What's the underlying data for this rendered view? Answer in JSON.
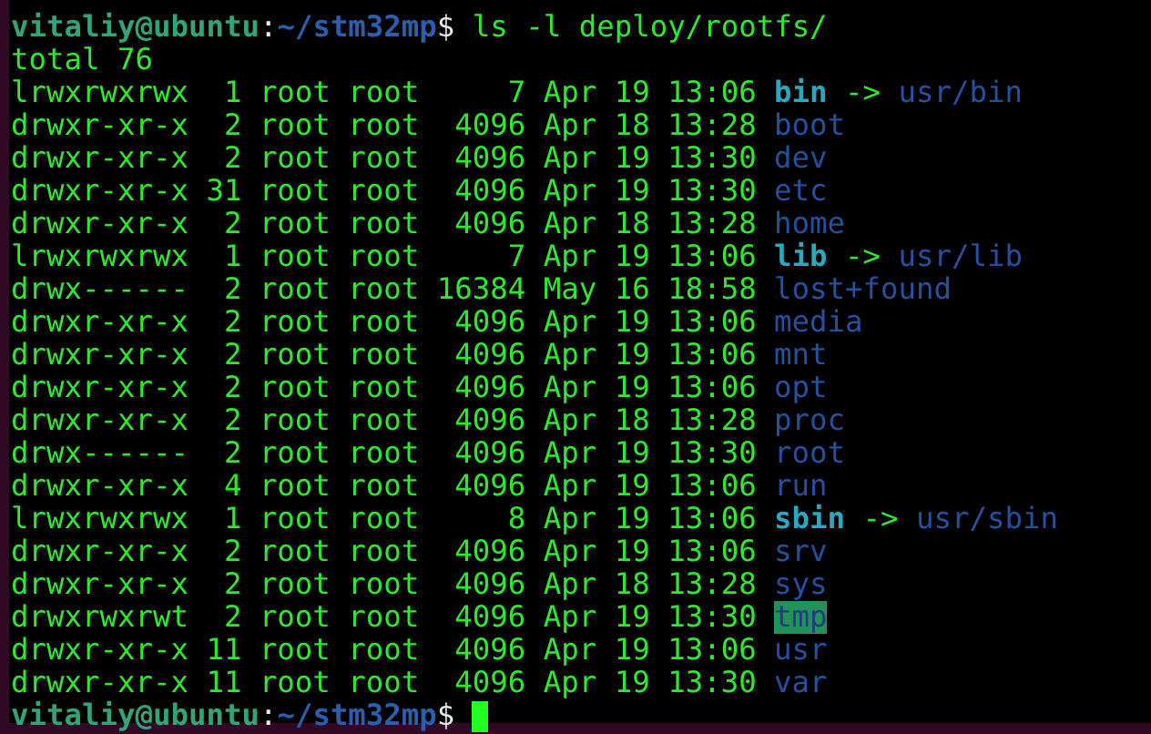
{
  "terminal": {
    "command_prompt": {
      "user_host": "vitaliy@ubuntu",
      "separator": ":",
      "path": "~/stm32mp",
      "symbol": "$",
      "command": "ls -l deploy/rootfs/"
    },
    "total": "total 76",
    "entries": [
      {
        "info": "lrwxrwxrwx  1 root root     7 Apr 19 13:06",
        "name": "bin",
        "kind": "link",
        "arrow": "->",
        "target": "usr/bin"
      },
      {
        "info": "drwxr-xr-x  2 root root  4096 Apr 18 13:28",
        "name": "boot",
        "kind": "dir"
      },
      {
        "info": "drwxr-xr-x  2 root root  4096 Apr 19 13:30",
        "name": "dev",
        "kind": "dir"
      },
      {
        "info": "drwxr-xr-x 31 root root  4096 Apr 19 13:30",
        "name": "etc",
        "kind": "dir"
      },
      {
        "info": "drwxr-xr-x  2 root root  4096 Apr 18 13:28",
        "name": "home",
        "kind": "dir"
      },
      {
        "info": "lrwxrwxrwx  1 root root     7 Apr 19 13:06",
        "name": "lib",
        "kind": "link",
        "arrow": "->",
        "target": "usr/lib"
      },
      {
        "info": "drwx------  2 root root 16384 May 16 18:58",
        "name": "lost+found",
        "kind": "dir"
      },
      {
        "info": "drwxr-xr-x  2 root root  4096 Apr 19 13:06",
        "name": "media",
        "kind": "dir"
      },
      {
        "info": "drwxr-xr-x  2 root root  4096 Apr 19 13:06",
        "name": "mnt",
        "kind": "dir"
      },
      {
        "info": "drwxr-xr-x  2 root root  4096 Apr 19 13:06",
        "name": "opt",
        "kind": "dir"
      },
      {
        "info": "drwxr-xr-x  2 root root  4096 Apr 18 13:28",
        "name": "proc",
        "kind": "dir"
      },
      {
        "info": "drwx------  2 root root  4096 Apr 19 13:30",
        "name": "root",
        "kind": "dir"
      },
      {
        "info": "drwxr-xr-x  4 root root  4096 Apr 19 13:06",
        "name": "run",
        "kind": "dir"
      },
      {
        "info": "lrwxrwxrwx  1 root root     8 Apr 19 13:06",
        "name": "sbin",
        "kind": "link",
        "arrow": "->",
        "target": "usr/sbin"
      },
      {
        "info": "drwxr-xr-x  2 root root  4096 Apr 19 13:06",
        "name": "srv",
        "kind": "dir"
      },
      {
        "info": "drwxr-xr-x  2 root root  4096 Apr 18 13:28",
        "name": "sys",
        "kind": "dir"
      },
      {
        "info": "drwxrwxrwt  2 root root  4096 Apr 19 13:30",
        "name": "tmp",
        "kind": "sticky"
      },
      {
        "info": "drwxr-xr-x 11 root root  4096 Apr 19 13:06",
        "name": "usr",
        "kind": "dir"
      },
      {
        "info": "drwxr-xr-x 11 root root  4096 Apr 19 13:30",
        "name": "var",
        "kind": "dir"
      }
    ],
    "input_prompt": {
      "user_host": "vitaliy@ubuntu",
      "separator": ":",
      "path": "~/stm32mp",
      "symbol": "$"
    }
  }
}
